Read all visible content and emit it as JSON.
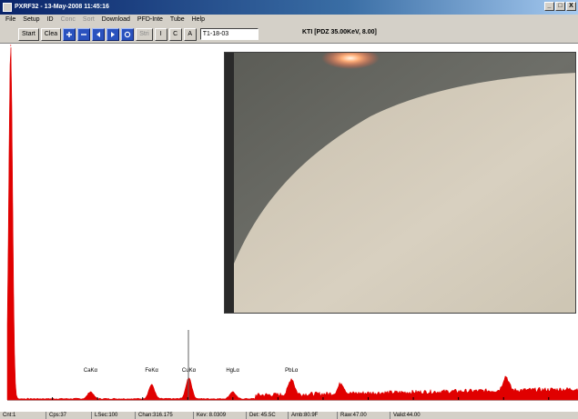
{
  "window": {
    "title": "PXRF32 - 13-May-2008 11:45:16",
    "min": "_",
    "max": "□",
    "close": "X"
  },
  "menu": [
    {
      "label": "File",
      "enabled": true
    },
    {
      "label": "Setup",
      "enabled": true
    },
    {
      "label": "ID",
      "enabled": true
    },
    {
      "label": "Conc",
      "enabled": false
    },
    {
      "label": "Sort",
      "enabled": false
    },
    {
      "label": "Download",
      "enabled": true
    },
    {
      "label": "PFD-Inte",
      "enabled": true
    },
    {
      "label": "Tube",
      "enabled": true
    },
    {
      "label": "Help",
      "enabled": true
    }
  ],
  "toolbar": {
    "start": "Start",
    "clear": "Clea",
    "icons": [
      "zoom-in-icon",
      "zoom-out-icon",
      "prev-icon",
      "next-icon",
      "refresh-icon"
    ],
    "disabled_btn": "Stri",
    "btn_i": "I",
    "btn_c": "C",
    "btn_a": "A",
    "sample_id": "T1-18-03",
    "status": "KTI  [PDZ 35.00KeV, 8.00]"
  },
  "chart_data": {
    "type": "area",
    "xlabel": "",
    "ylabel": "",
    "xlim": [
      0,
      25.3
    ],
    "ticks": [
      "2.00",
      "4.00",
      "6.00",
      "8.00",
      "10.00",
      "12.00",
      "14.00",
      "16.00",
      "18.00",
      "20.00",
      "22.00",
      "24.00"
    ],
    "peaks": [
      {
        "x": 0.15,
        "y": 1.0
      },
      {
        "x": 3.69,
        "y": 0.02
      },
      {
        "x": 6.4,
        "y": 0.04
      },
      {
        "x": 8.05,
        "y": 0.06
      },
      {
        "x": 9.99,
        "y": 0.02
      },
      {
        "x": 12.6,
        "y": 0.045
      },
      {
        "x": 14.8,
        "y": 0.03
      },
      {
        "x": 22.1,
        "y": 0.04
      }
    ],
    "annotations": [
      {
        "label": "CaKα",
        "x": 3.69
      },
      {
        "label": "FeKα",
        "x": 6.4
      },
      {
        "label": "CuKα",
        "x": 8.05
      },
      {
        "label": "HgLα",
        "x": 9.99
      },
      {
        "label": "PbLα",
        "x": 12.6
      }
    ],
    "cursor_x": 8.03,
    "color": "#e00000"
  },
  "statusbar": [
    "Cnt:1",
    "Cps:37",
    "LSec:100",
    "Chan:316.175",
    "Kev: 8.0309",
    "Det: 45.5C",
    "Amb:80.9F",
    "Raw:47.00",
    "Valid:44.00"
  ],
  "colors": {
    "spectrum": "#e00000",
    "titlebar": "#0a246a",
    "chrome": "#d4d0c8"
  }
}
